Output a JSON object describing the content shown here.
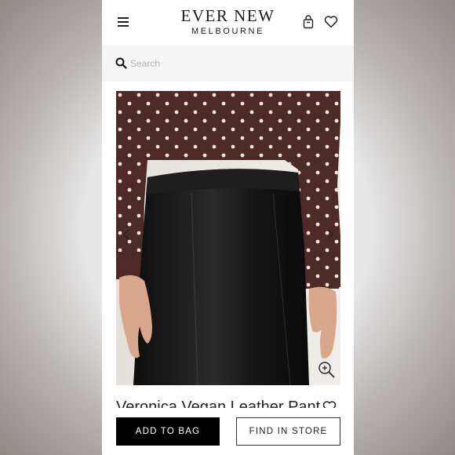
{
  "header": {
    "brand_name": "EVER NEW",
    "brand_location": "MELBOURNE",
    "icons": [
      "menu-icon",
      "shopping-bag-icon",
      "heart-icon"
    ]
  },
  "search": {
    "placeholder": "Search",
    "icon": "search-icon"
  },
  "product": {
    "title": "Veronica Vegan Leather Pants",
    "image_icons": [
      "chevron-left-icon",
      "chevron-right-icon",
      "zoom-in-icon"
    ]
  },
  "actions": {
    "add_to_bag": "ADD TO BAG",
    "find_in_store": "FIND IN STORE"
  },
  "colors": {
    "primary": "#000000",
    "background": "#ffffff",
    "search_bg": "#f5f5f5",
    "blouse": "#4e2a27",
    "pants": "#1a1a1a"
  }
}
